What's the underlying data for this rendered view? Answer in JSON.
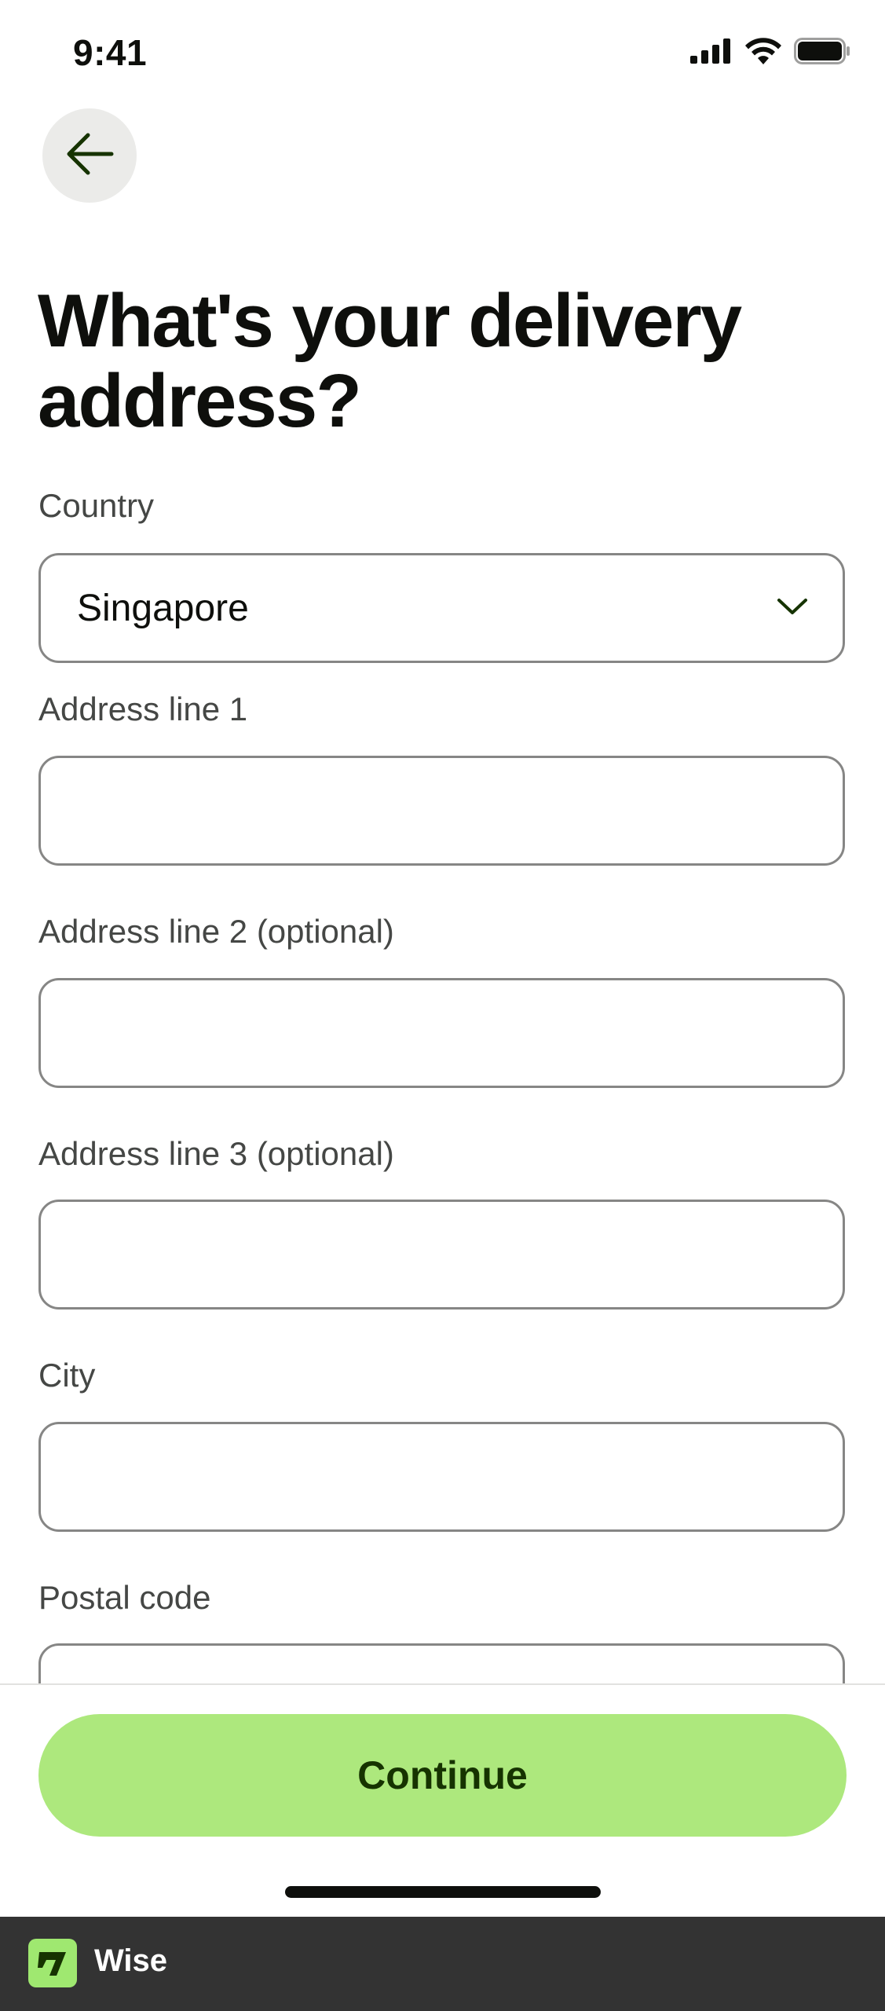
{
  "status_bar": {
    "time": "9:41"
  },
  "header": {
    "back_icon": "arrow-left-icon"
  },
  "page": {
    "title": "What's your delivery address?"
  },
  "form": {
    "country": {
      "label": "Country",
      "value": "Singapore",
      "icon": "chevron-down-icon"
    },
    "address_line_1": {
      "label": "Address line 1",
      "value": ""
    },
    "address_line_2": {
      "label": "Address line 2 (optional)",
      "value": ""
    },
    "address_line_3": {
      "label": "Address line 3 (optional)",
      "value": ""
    },
    "city": {
      "label": "City",
      "value": ""
    },
    "postal_code": {
      "label": "Postal code",
      "value": ""
    }
  },
  "footer": {
    "continue_label": "Continue"
  },
  "brand": {
    "name": "Wise",
    "logo_icon": "wise-logo-icon"
  },
  "colors": {
    "accent": "#ade87d",
    "accent_text": "#163300",
    "brand_bar": "#333333",
    "brand_logo": "#9fe870",
    "border": "#868685",
    "label": "#454745"
  }
}
